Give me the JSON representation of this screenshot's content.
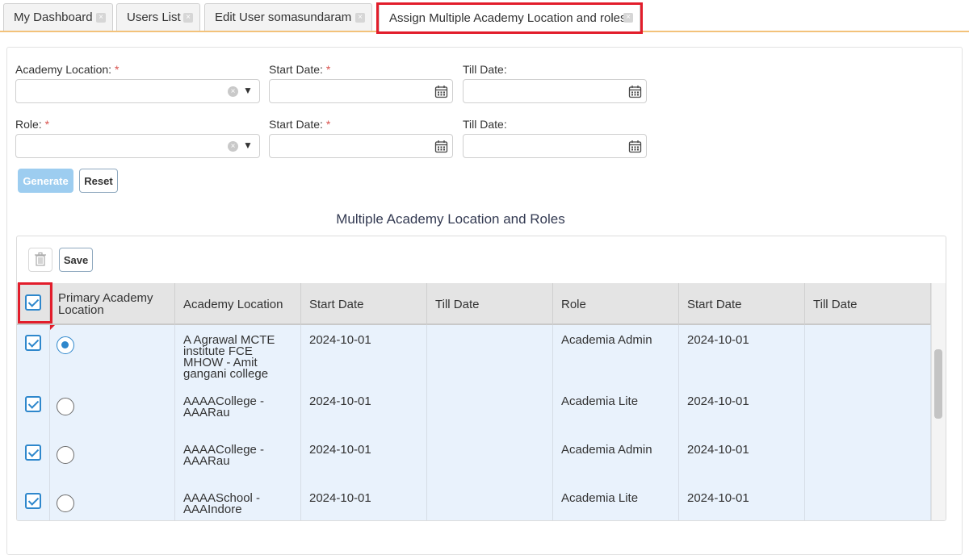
{
  "tabs": [
    {
      "label": "My Dashboard"
    },
    {
      "label": "Users List"
    },
    {
      "label": "Edit User somasundaram"
    },
    {
      "label": "Assign Multiple Academy Location and roles"
    }
  ],
  "form": {
    "academy_location_label": "Academy Location:",
    "role_label": "Role:",
    "start_date_label": "Start Date:",
    "till_date_label": "Till Date:",
    "required_mark": "*",
    "generate_label": "Generate",
    "reset_label": "Reset"
  },
  "section_title": "Multiple Academy Location and Roles",
  "grid": {
    "save_label": "Save",
    "columns": [
      "Primary Academy Location",
      "Academy Location",
      "Start Date",
      "Till Date",
      "Role",
      "Start Date",
      "Till Date"
    ],
    "rows": [
      {
        "location": "A Agrawal MCTE institute FCE MHOW - Amit gangani college",
        "start": "2024-10-01",
        "till": "",
        "role": "Academia Admin",
        "role_start": "2024-10-01",
        "role_till": "",
        "primary": true
      },
      {
        "location": "AAAACollege - AAARau",
        "start": "2024-10-01",
        "till": "",
        "role": "Academia Lite",
        "role_start": "2024-10-01",
        "role_till": "",
        "primary": false
      },
      {
        "location": "AAAACollege - AAARau",
        "start": "2024-10-01",
        "till": "",
        "role": "Academia Admin",
        "role_start": "2024-10-01",
        "role_till": "",
        "primary": false
      },
      {
        "location": "AAAASchool - AAAIndore",
        "start": "2024-10-01",
        "till": "",
        "role": "Academia Lite",
        "role_start": "2024-10-01",
        "role_till": "",
        "primary": false
      }
    ]
  },
  "colors": {
    "accent": "#2e87cc",
    "highlight": "#e21d2b",
    "tab_underline": "#f3c27a"
  }
}
